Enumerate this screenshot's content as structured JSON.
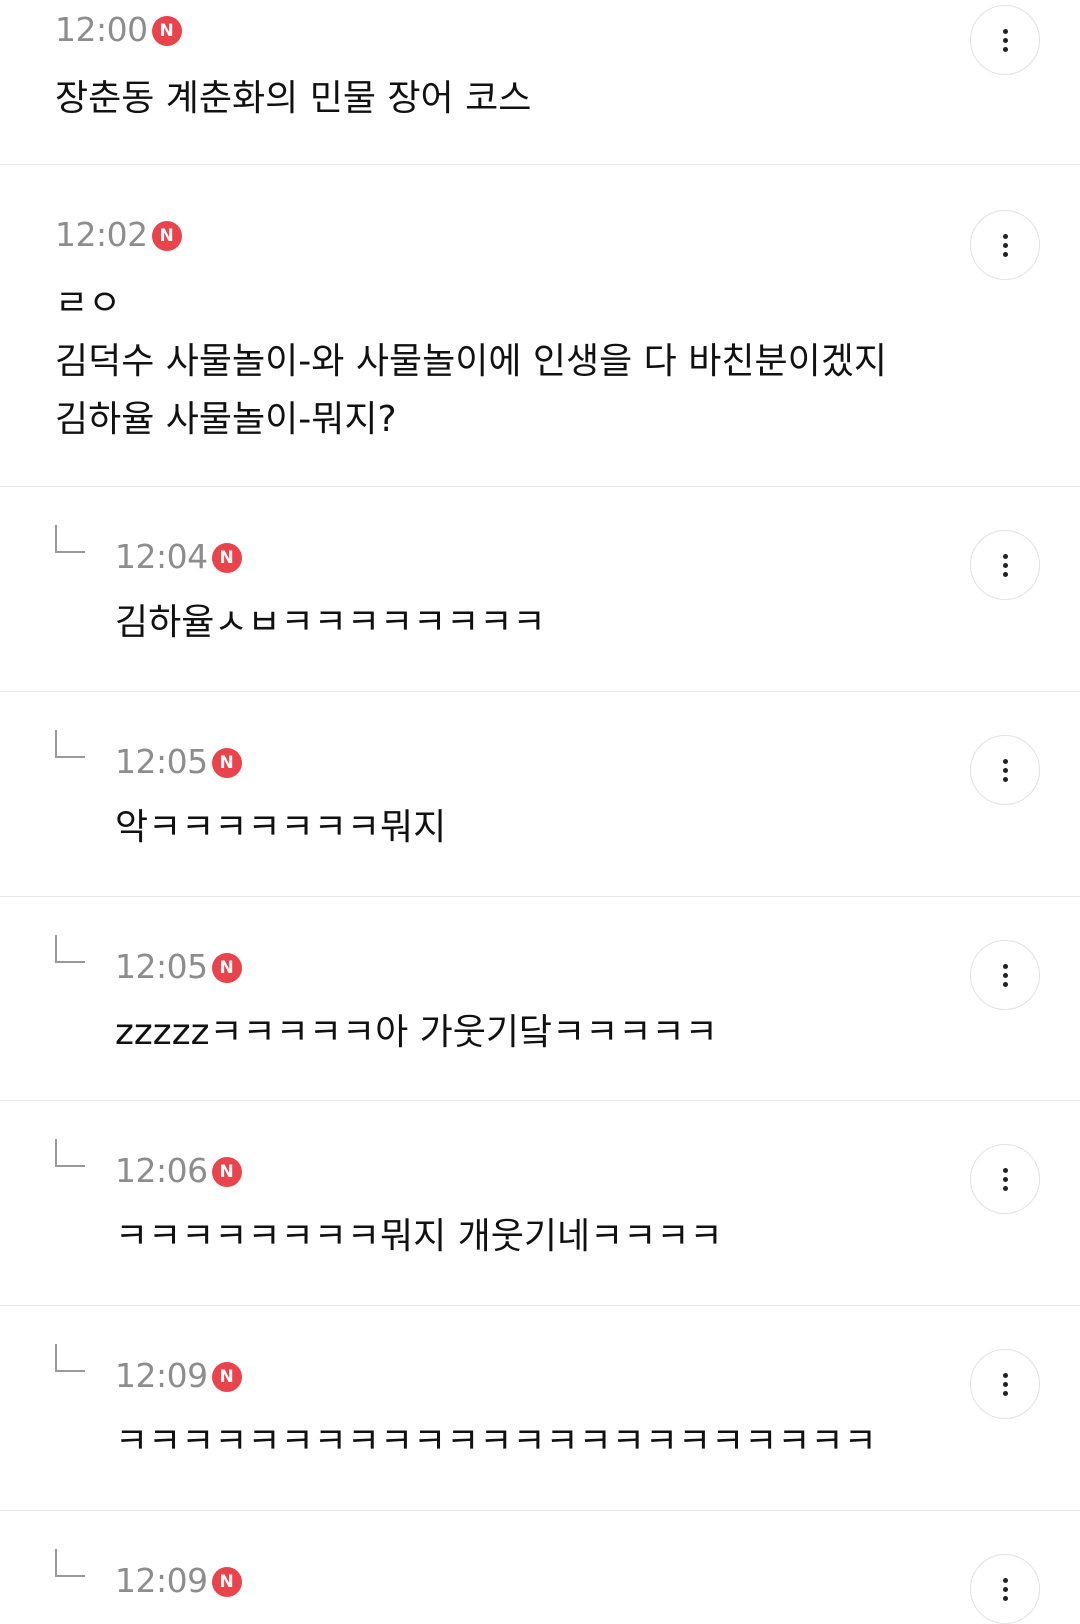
{
  "badge_label": "N",
  "colors": {
    "badge": "#e9434b",
    "time": "#8d8d8d",
    "divider": "#e6e6e6"
  },
  "icons": {
    "more": "more-vertical-icon",
    "reply": "reply-arrow-icon",
    "new": "new-badge-icon"
  },
  "comments": [
    {
      "time": "12:00",
      "is_reply": false,
      "lines": [
        "장춘동 계춘화의 민물 장어 코스"
      ]
    },
    {
      "time": "12:02",
      "is_reply": false,
      "lines": [
        "ㄹㅇ",
        "김덕수 사물놀이-와 사물놀이에 인생을 다 바친분이겠지",
        "김하율 사물놀이-뭐지?"
      ]
    },
    {
      "time": "12:04",
      "is_reply": true,
      "lines": [
        "김하율ㅅㅂㅋㅋㅋㅋㅋㅋㅋㅋ"
      ]
    },
    {
      "time": "12:05",
      "is_reply": true,
      "lines": [
        "악ㅋㅋㅋㅋㅋㅋㅋ뭐지"
      ]
    },
    {
      "time": "12:05",
      "is_reply": true,
      "lines": [
        "zzzzzㅋㅋㅋㅋㅋ아 가웃기닼ㅋㅋㅋㅋㅋ"
      ]
    },
    {
      "time": "12:06",
      "is_reply": true,
      "lines": [
        "ㅋㅋㅋㅋㅋㅋㅋㅋ뭐지 개웃기네ㅋㅋㅋㅋ"
      ]
    },
    {
      "time": "12:09",
      "is_reply": true,
      "lines": [
        "ㅋㅋㅋㅋㅋㅋㅋㅋㅋㅋㅋㅋㅋㅋㅋㅋㅋㅋㅋㅋㅋㅋㅋ"
      ]
    },
    {
      "time": "12:09",
      "is_reply": true,
      "lines": []
    }
  ]
}
